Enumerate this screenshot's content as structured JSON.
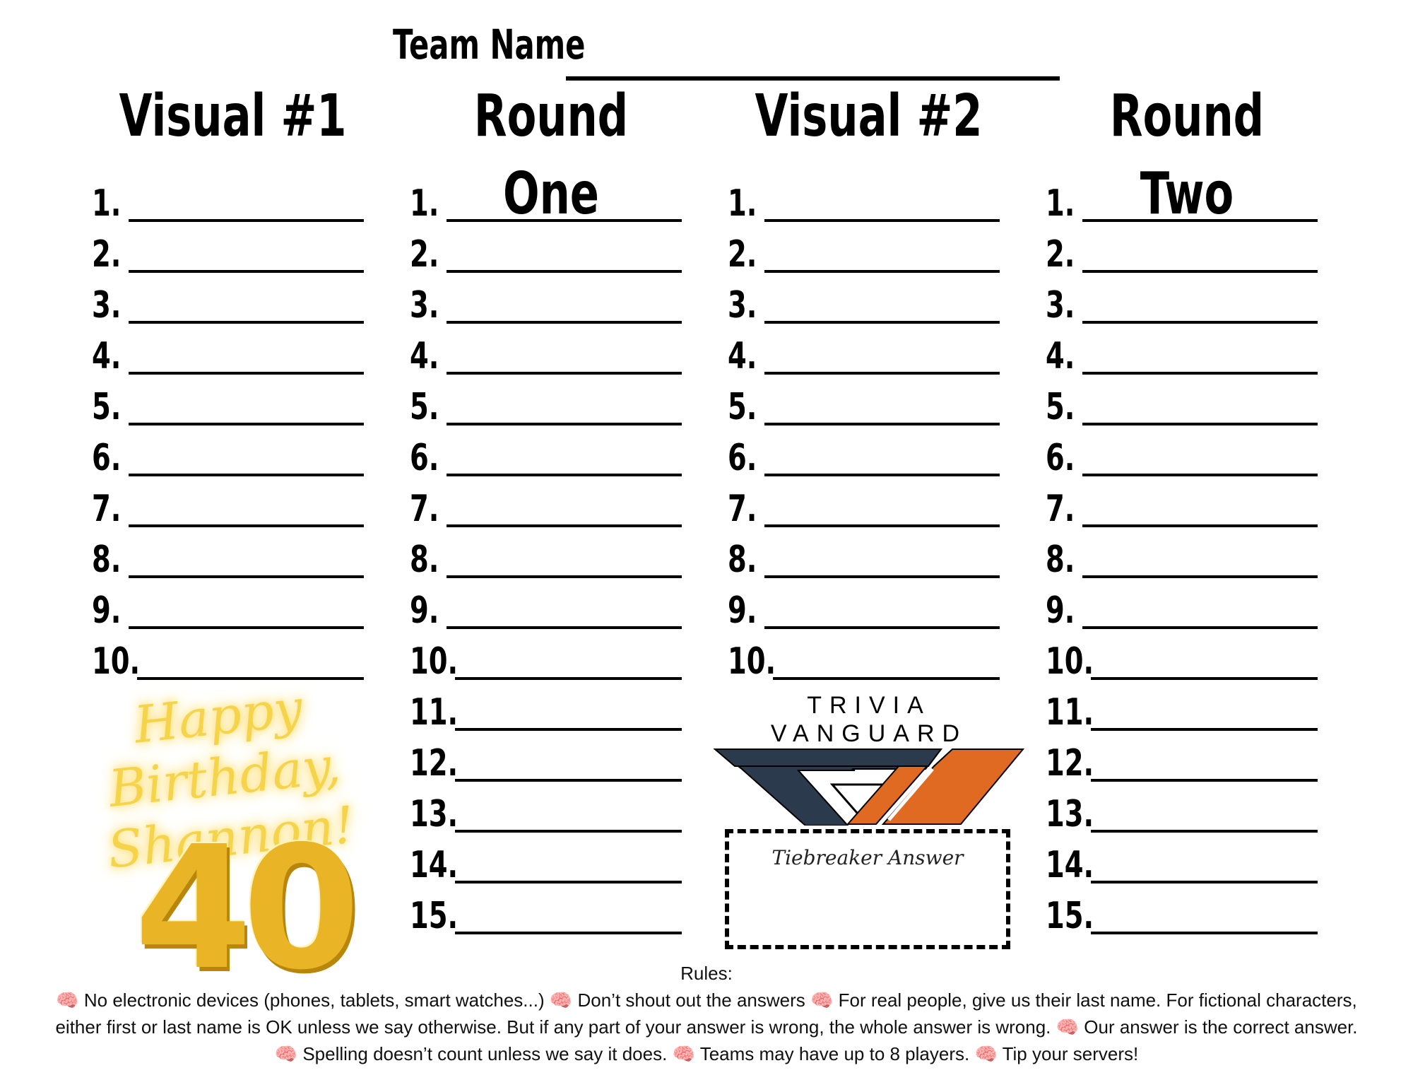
{
  "team": {
    "label": "Team Name"
  },
  "columns": [
    {
      "title": "Visual #1",
      "numbers": [
        "1.",
        "2.",
        "3.",
        "4.",
        "5.",
        "6.",
        "7.",
        "8.",
        "9.",
        "10."
      ]
    },
    {
      "title": "Round One",
      "numbers": [
        "1.",
        "2.",
        "3.",
        "4.",
        "5.",
        "6.",
        "7.",
        "8.",
        "9.",
        "10.",
        "11.",
        "12.",
        "13.",
        "14.",
        "15."
      ]
    },
    {
      "title": "Visual #2",
      "numbers": [
        "1.",
        "2.",
        "3.",
        "4.",
        "5.",
        "6.",
        "7.",
        "8.",
        "9.",
        "10."
      ]
    },
    {
      "title": "Round Two",
      "numbers": [
        "1.",
        "2.",
        "3.",
        "4.",
        "5.",
        "6.",
        "7.",
        "8.",
        "9.",
        "10.",
        "11.",
        "12.",
        "13.",
        "14.",
        "15."
      ]
    }
  ],
  "birthday": {
    "line1": "Happy Birthday,",
    "line2": "Shannon!",
    "number": "40"
  },
  "logo": {
    "text": "TRIVIA VANGUARD",
    "colors": {
      "navy": "#2b3a4d",
      "orange": "#e06a22"
    }
  },
  "tiebreaker": {
    "label": "Tiebreaker Answer"
  },
  "rules": {
    "heading": "Rules:",
    "bullet_icon": "brain-icon",
    "items": [
      "No electronic devices (phones, tablets, smart watches...)",
      "Don’t shout out the answers",
      "For real people, give us their last name. For fictional characters, either first or last name is OK unless we say otherwise. But if any part of your answer is wrong, the whole answer is wrong.",
      "Our answer is the correct answer.",
      "Spelling doesn’t count unless we say it does.",
      "Teams may have up to 8 players.",
      "Tip your servers!"
    ]
  }
}
